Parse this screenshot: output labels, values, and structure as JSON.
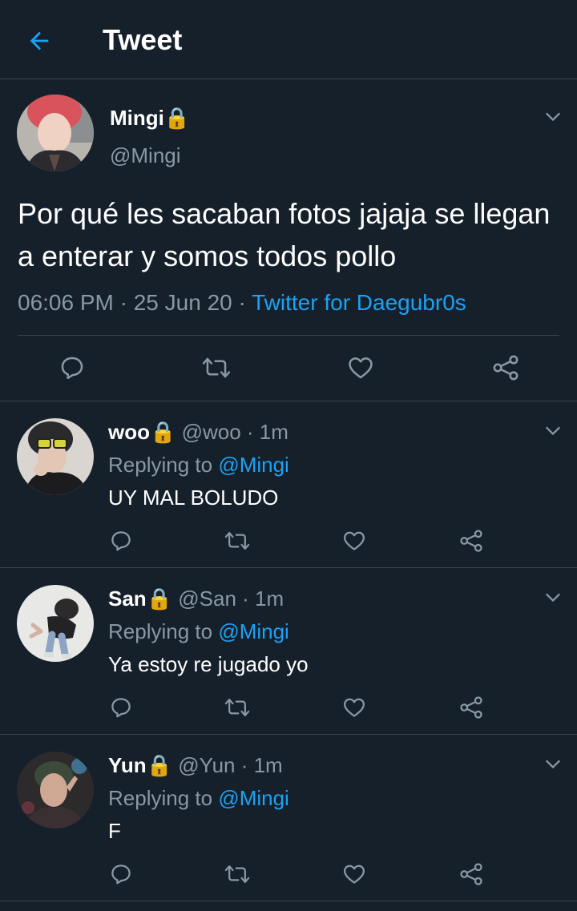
{
  "header": {
    "title": "Tweet"
  },
  "main_tweet": {
    "name": "Mingi",
    "lock": "🔒",
    "handle": "@Mingi",
    "text": "Por qué les sacaban fotos jajaja se llegan a enterar y somos todos pollo",
    "time": "06:06 PM · 25 Jun 20 · ",
    "source": "Twitter for Daegubr0s"
  },
  "replies": [
    {
      "name": "woo",
      "lock": "🔒",
      "meta": " @woo · 1m",
      "replying_prefix": "Replying to ",
      "replying_to": "@Mingi",
      "text": "UY MAL BOLUDO"
    },
    {
      "name": "San",
      "lock": "🔒",
      "meta": " @San · 1m",
      "replying_prefix": "Replying to ",
      "replying_to": "@Mingi",
      "text": "Ya estoy re jugado yo"
    },
    {
      "name": "Yun",
      "lock": "🔒",
      "meta": " @Yun · 1m",
      "replying_prefix": "Replying to ",
      "replying_to": "@Mingi",
      "text": "F"
    }
  ],
  "colors": {
    "background": "#15202b",
    "accent": "#1da1f2",
    "muted": "#8899a6",
    "divider": "#38444d"
  },
  "icons": [
    "back-arrow-icon",
    "chevron-down-icon",
    "reply-icon",
    "retweet-icon",
    "like-icon",
    "share-icon",
    "lock-icon"
  ]
}
